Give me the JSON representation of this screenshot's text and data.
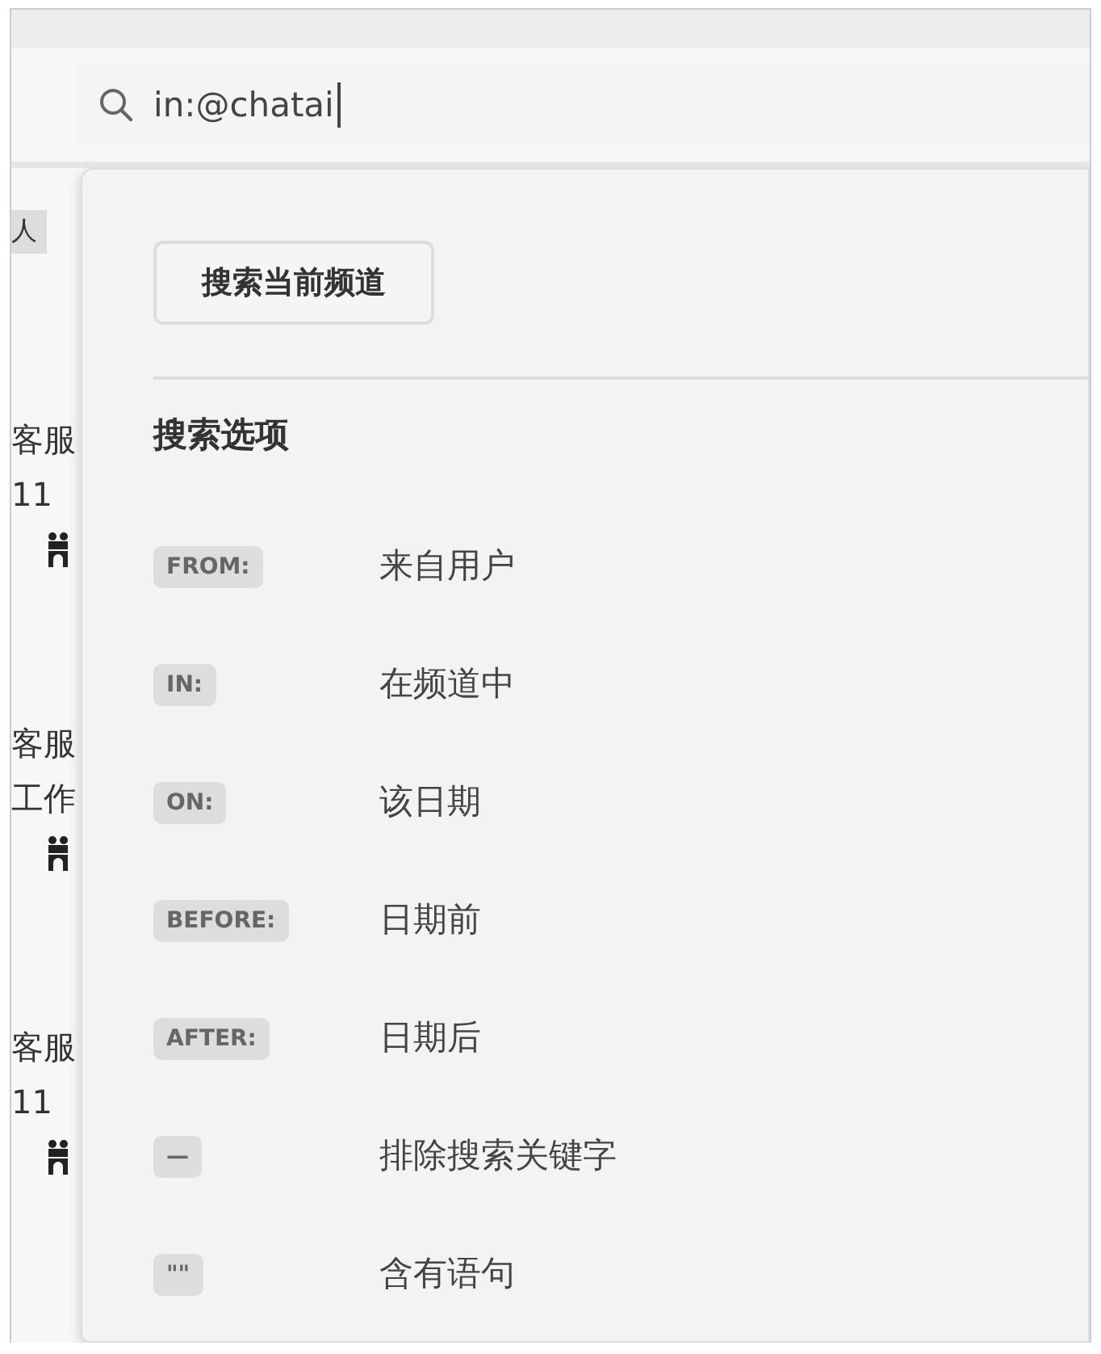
{
  "search": {
    "value": "in:@chatai"
  },
  "sidebar": {
    "tag": "人",
    "items": [
      {
        "lines": [
          "客服",
          "11"
        ]
      },
      {
        "lines": [
          "客服",
          "工作"
        ]
      },
      {
        "lines": [
          "客服",
          "11"
        ]
      }
    ]
  },
  "dropdown": {
    "button": "搜索当前频道",
    "section_title": "搜索选项",
    "options": [
      {
        "key": "FROM:",
        "label": "来自用户"
      },
      {
        "key": "IN:",
        "label": "在频道中"
      },
      {
        "key": "ON:",
        "label": "该日期"
      },
      {
        "key": "BEFORE:",
        "label": "日期前"
      },
      {
        "key": "AFTER:",
        "label": "日期后"
      },
      {
        "key": "—",
        "label": "排除搜索关键字"
      },
      {
        "key": "\"\"",
        "label": "含有语句"
      }
    ]
  }
}
